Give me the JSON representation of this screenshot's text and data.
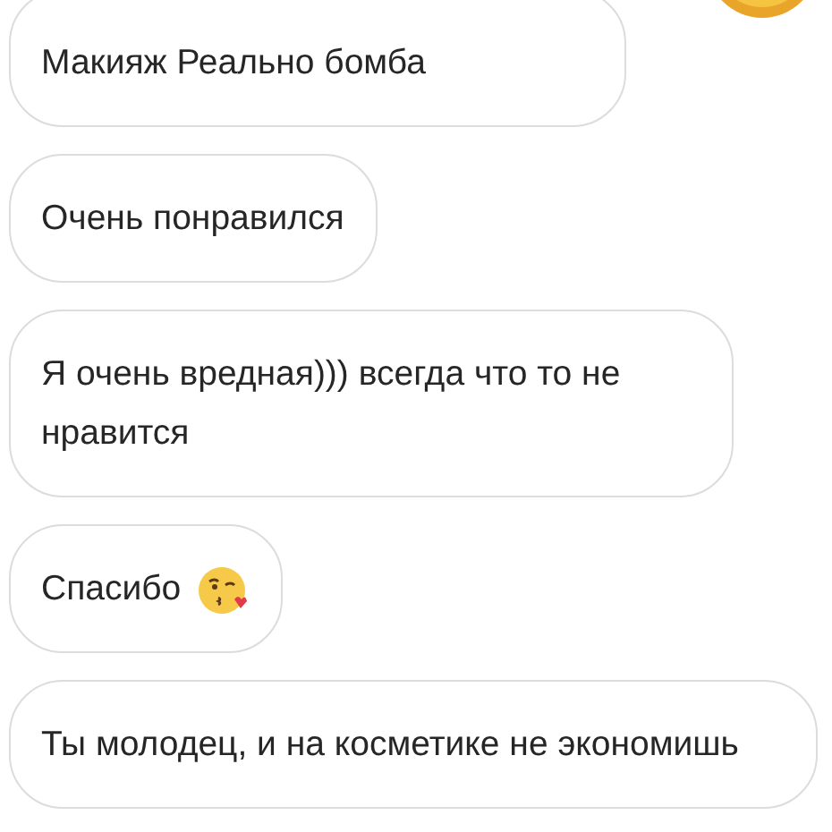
{
  "messages": [
    {
      "kind": "plain",
      "text": "Макияж Реально бомба"
    },
    {
      "kind": "plain",
      "text": "Очень понравился"
    },
    {
      "kind": "plain",
      "text": "Я очень вредная))) всегда что то не нравится"
    },
    {
      "kind": "emoji",
      "text": "Спасибо"
    },
    {
      "kind": "plain",
      "text": "Ты молодец, и на косметике не экономишь"
    }
  ]
}
